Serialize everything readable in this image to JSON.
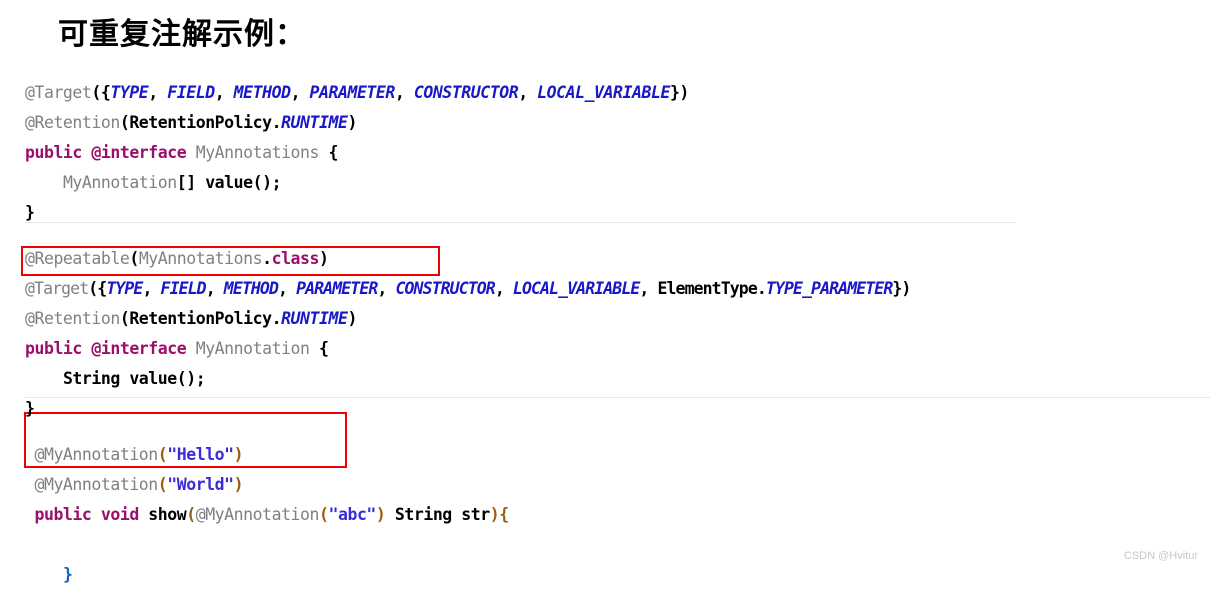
{
  "page": {
    "title": "可重复注解示例：",
    "watermark": "CSDN @Hvitur",
    "background_color": "#ffffff"
  },
  "colors": {
    "annotation_gray": "#808080",
    "keyword_purple": "#9A0F6B",
    "constant_blue": "#1818C8",
    "string_blue": "#3A2AD8",
    "bracket_black": "#000000",
    "bracket_orange": "#9B5C10",
    "highlight_red": "#ef0000",
    "separator_gray": "#e3e8ef",
    "watermark_gray": "#c8c8c8"
  },
  "code": {
    "block1": {
      "line1": {
        "anno": "@Target",
        "open": "({",
        "c1": "TYPE",
        "sep1": ", ",
        "c2": "FIELD",
        "sep2": ", ",
        "c3": "METHOD",
        "sep3": ", ",
        "c4": "PARAMETER",
        "sep4": ", ",
        "c5": "CONSTRUCTOR",
        "sep5": ", ",
        "c6": "LOCAL_VARIABLE",
        "close": "})"
      },
      "line2": {
        "anno": "@Retention",
        "open": "(",
        "type": "RetentionPolicy.",
        "const": "RUNTIME",
        "close": ")"
      },
      "line3": {
        "kw": "public @interface",
        "space": " ",
        "name": "MyAnnotations",
        "brace": " {"
      },
      "line4": {
        "indent": "    ",
        "type": "MyAnnotation",
        "brackets": "[]",
        "space": " ",
        "member": "value();"
      },
      "line5": {
        "brace": "}"
      }
    },
    "block2": {
      "line1": {
        "anno": "@Repeatable",
        "open": "(",
        "name": "MyAnnotations",
        "dot": ".",
        "kw": "class",
        "close": ")"
      },
      "line2": {
        "anno": "@Target",
        "open": "({",
        "c1": "TYPE",
        "sep1": ", ",
        "c2": "FIELD",
        "sep2": ", ",
        "c3": "METHOD",
        "sep3": ", ",
        "c4": "PARAMETER",
        "sep4": ", ",
        "c5": "CONSTRUCTOR",
        "sep5": ", ",
        "c6": "LOCAL_VARIABLE",
        "sep6": ", ",
        "type": "ElementType.",
        "c7": "TYPE_PARAMETER",
        "close": "})"
      },
      "line3": {
        "anno": "@Retention",
        "open": "(",
        "type": "RetentionPolicy.",
        "const": "RUNTIME",
        "close": ")"
      },
      "line4": {
        "kw": "public @interface",
        "space": " ",
        "name": "MyAnnotation",
        "brace": " {"
      },
      "line5": {
        "indent": "    ",
        "type": "String",
        "space": " ",
        "member": "value();"
      },
      "line6": {
        "brace": "}"
      }
    },
    "block3": {
      "line1": {
        "anno": "@MyAnnotation",
        "open": "(",
        "str": "\"Hello\"",
        "close": ")"
      },
      "line2": {
        "anno": "@MyAnnotation",
        "open": "(",
        "str": "\"World\"",
        "close": ")"
      },
      "line3": {
        "indent": " ",
        "kw": "public void",
        "space": " ",
        "method": "show",
        "open": "(",
        "anno": "@MyAnnotation",
        "open2": "(",
        "str": "\"abc\"",
        "close2": ")",
        "space2": " ",
        "type": "String",
        "space3": " ",
        "param": "str",
        "close": ")",
        "brace": "{"
      },
      "line4": {
        "indent": "    ",
        "brace": "}"
      }
    }
  }
}
